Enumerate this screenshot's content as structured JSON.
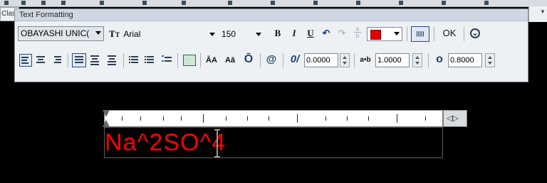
{
  "window": {
    "left_label": "Clas",
    "panel_title": "Text Formatting"
  },
  "row1": {
    "style_value": "OBAYASHI UNIC(",
    "font_icon_text": "T",
    "font_value": "Arial",
    "height_value": "150",
    "bold_label": "B",
    "italic_label": "I",
    "underline_label": "U",
    "undo_symbol": "↶",
    "redo_symbol": "↷",
    "stack_top": "a",
    "stack_bottom": "b",
    "color_value": "#e00000",
    "ruler_button_text": "|||||",
    "ok_label": "OK",
    "options_symbol": "⌄"
  },
  "row2": {
    "insert_field_symbol": "@",
    "oblique_label": "0/",
    "oblique_value": "0.0000",
    "tracking_label": "a•b",
    "tracking_value": "1.0000",
    "width_label": "o",
    "width_value": "0.8000",
    "upper_label": "ĀA",
    "lower_label": "Aā",
    "overline_label": "Ō"
  },
  "editor": {
    "text": "Na^2SO^4",
    "text_color": "#ff0000",
    "ruler_end_symbol": "◁▷"
  },
  "colors": {
    "panel_bg": "#eef1f4",
    "title_bg": "#cfd7e2",
    "canvas": "#000000"
  }
}
